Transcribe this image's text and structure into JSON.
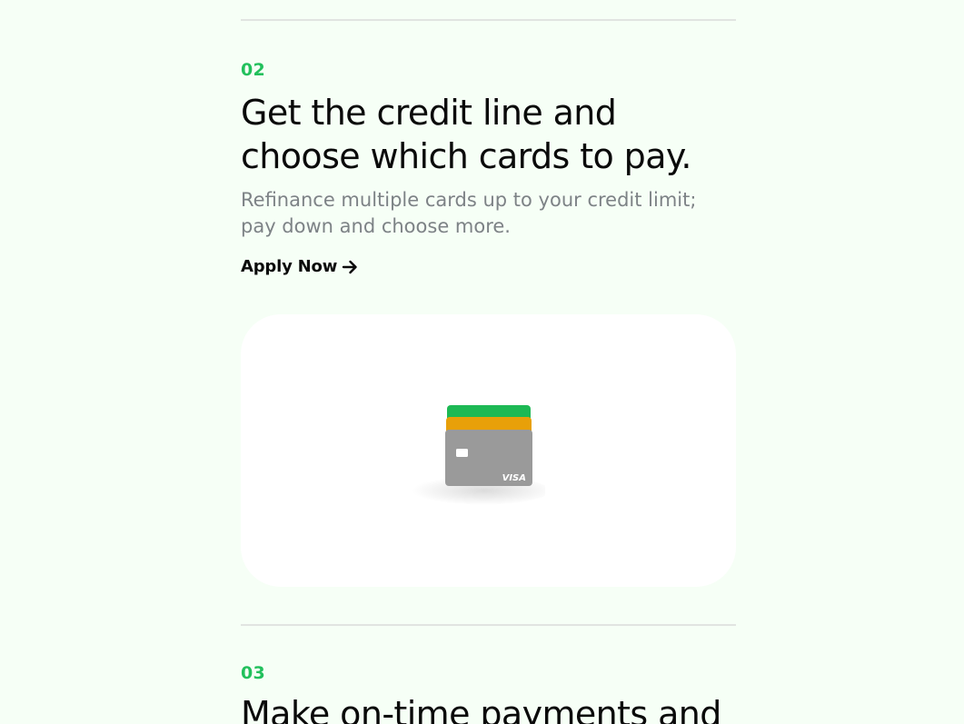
{
  "steps": [
    {
      "number": "02",
      "headline_line1": "Get the credit line and",
      "headline_line2": "choose which cards to pay.",
      "subtext_line1": "Refinance multiple cards up to your credit limit;",
      "subtext_line2": "pay down and choose more.",
      "cta_label": "Apply Now",
      "cta_icon": "arrow-right-icon",
      "illustration": {
        "cards": [
          {
            "name": "green-card",
            "color": "#1db954"
          },
          {
            "name": "orange-card",
            "color": "#e8a009"
          },
          {
            "name": "gray-visa-card",
            "color": "#9a9a9a",
            "brand": "VISA"
          }
        ]
      }
    },
    {
      "number": "03",
      "headline_line1": "Make on-time payments and"
    }
  ],
  "colors": {
    "background": "#f6fff6",
    "accent": "#22c05c",
    "text": "#0a0a0a",
    "muted": "#7d8286"
  }
}
